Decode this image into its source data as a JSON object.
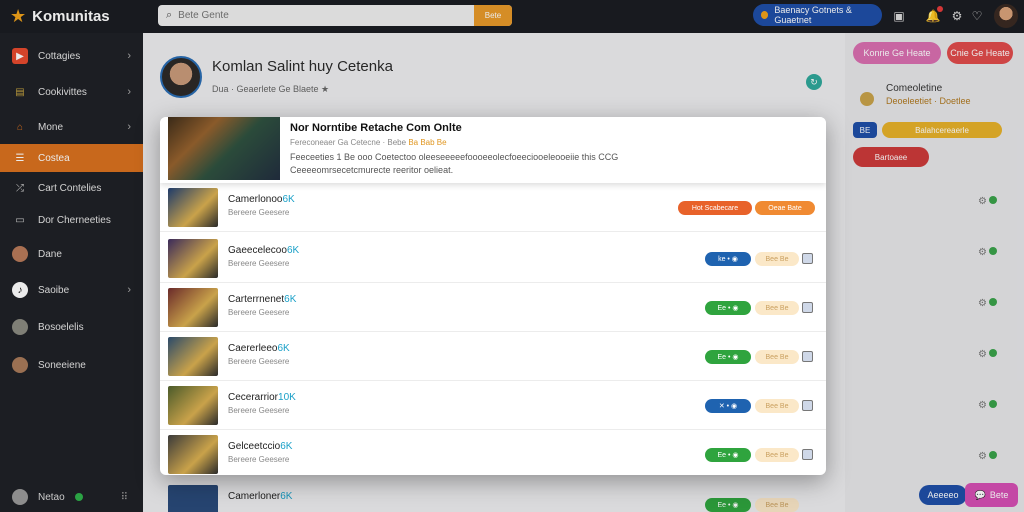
{
  "app": {
    "name": "Komunitas"
  },
  "search": {
    "placeholder": "Bete Gente",
    "button_label": "Bete"
  },
  "top_pill": {
    "label": "Baenacy Gotnets & Guaetnet"
  },
  "sidebar": {
    "items": [
      {
        "label": "Cottagies",
        "icon": "video-icon",
        "color": "#e64a2e",
        "chevron": true
      },
      {
        "label": "Cookivittes",
        "icon": "briefcase-icon",
        "color": "#c9a640",
        "chevron": true
      },
      {
        "label": "Mone",
        "icon": "home-icon",
        "color": "#d9711f",
        "chevron": true
      },
      {
        "label": "Costea",
        "icon": "list-icon",
        "color": "#ffffff",
        "chevron": false,
        "active": true
      },
      {
        "label": "Cart Contelies",
        "icon": "share-icon",
        "color": "#cccccc",
        "chevron": false
      },
      {
        "label": "Dor Cherneeties",
        "icon": "screen-icon",
        "color": "#cccccc",
        "chevron": false
      },
      {
        "label": "Dane",
        "icon": "avatar-icon",
        "color": "#b87a5a",
        "chevron": false
      },
      {
        "label": "Saoibe",
        "icon": "tiktok-icon",
        "color": "#ffffff",
        "chevron": true
      },
      {
        "label": "Bosoelelis",
        "icon": "avatar-icon",
        "color": "#8a8a80",
        "chevron": false
      },
      {
        "label": "Soneeiene",
        "icon": "avatar-icon",
        "color": "#a87a5a",
        "chevron": false
      }
    ],
    "footer": {
      "label": "Netao",
      "icon": "grid-icon"
    }
  },
  "profile": {
    "name": "Komlan Salint huy Cetenka",
    "sub": "Dua · Geaerlete Ge Blaete ★"
  },
  "right_panel": {
    "btn1": "Konrie Ge Heate",
    "btn2": "Cnie Ge Heate",
    "title": "Comeoletine",
    "sub": "Deoeleetiet · Doetlee",
    "badge_a": "BE",
    "badge_b": "Balahcereaerle",
    "btn3": "Bartoaee"
  },
  "modal": {
    "title": "Nor Norntibe Retache Com Onlte",
    "meta": "Fereconeaer Ga Cetecne · Bebe",
    "meta_highlight": "Ba Bab Be",
    "desc": "Feeceeties 1 Be ooo Coetectoo oleeseeeeefoooeeolecfoeeciooeleooeiie this CCG Ceeeeomrsecetcmurecte reeritor oelieat."
  },
  "rows": [
    {
      "name": "Camerlonoo",
      "tag": "6K",
      "sub": "Bereere Geesere",
      "act1": "Hot Scabecare",
      "act2": "Oeae Bate",
      "act1_color": "#e8622a",
      "act2_color": "#f08a32",
      "act2_text_color": "#ffffff",
      "thumb": "#1d3a6a"
    },
    {
      "name": "Gaeecelecoo",
      "tag": "6K",
      "sub": "Bereere Geesere",
      "act1": "ke • ◉",
      "act2": "Bee Be",
      "act1_color": "#1f63b0",
      "act2_color": "#fbe8c8",
      "act2_text_color": "#caa060",
      "thumb": "#3a2a5a"
    },
    {
      "name": "Carterrnenet",
      "tag": "6K",
      "sub": "Bereere Geesere",
      "act1": "Ee • ◉",
      "act2": "Bee Be",
      "act1_color": "#2fa43e",
      "act2_color": "#fbe8c8",
      "act2_text_color": "#caa060",
      "thumb": "#6a2a2a"
    },
    {
      "name": "Caererleeo",
      "tag": "6K",
      "sub": "Bereere Geesere",
      "act1": "Ee • ◉",
      "act2": "Bee Be",
      "act1_color": "#2fa43e",
      "act2_color": "#fbe8c8",
      "act2_text_color": "#caa060",
      "thumb": "#2a4a6a"
    },
    {
      "name": "Cecerarrior",
      "tag": "10K",
      "sub": "Bereere Geesere",
      "act1": "✕ • ◉",
      "act2": "Bee Be",
      "act1_color": "#1f63b0",
      "act2_color": "#fbe8c8",
      "act2_text_color": "#caa060",
      "thumb": "#4a5a2a"
    },
    {
      "name": "Gelceetccio",
      "tag": "6K",
      "sub": "Bereere Geesere",
      "act1": "Ee • ◉",
      "act2": "Bee Be",
      "act1_color": "#2fa43e",
      "act2_color": "#fbe8c8",
      "act2_text_color": "#caa060",
      "thumb": "#3a3a3a"
    }
  ],
  "bg_row": {
    "name": "Camerloner",
    "tag": "6K",
    "sub": "Bereere Geesere",
    "act1": "Ee • ◉",
    "act2": "Bee Be"
  },
  "chat": {
    "btn1": "Aeeeeo",
    "btn2": "Bete"
  }
}
